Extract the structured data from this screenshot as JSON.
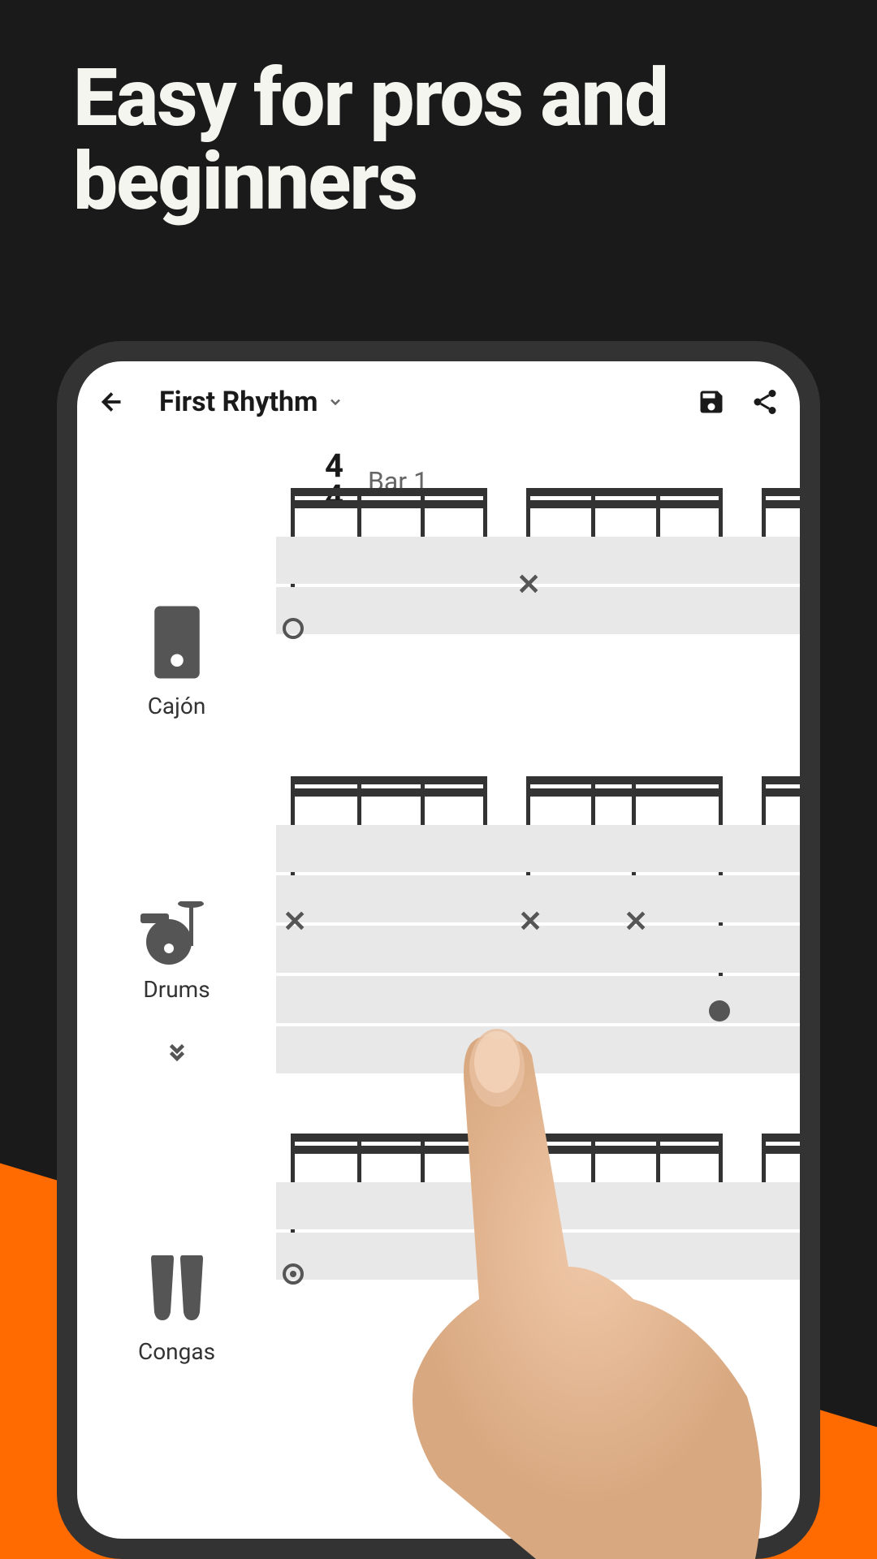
{
  "headline": "Easy for pros and beginners",
  "header": {
    "title": "First Rhythm"
  },
  "timeSignature": {
    "top": "4",
    "bottom": "4"
  },
  "barLabel": "Bar 1",
  "instruments": [
    {
      "name": "Cajón"
    },
    {
      "name": "Drums"
    },
    {
      "name": "Congas"
    }
  ]
}
